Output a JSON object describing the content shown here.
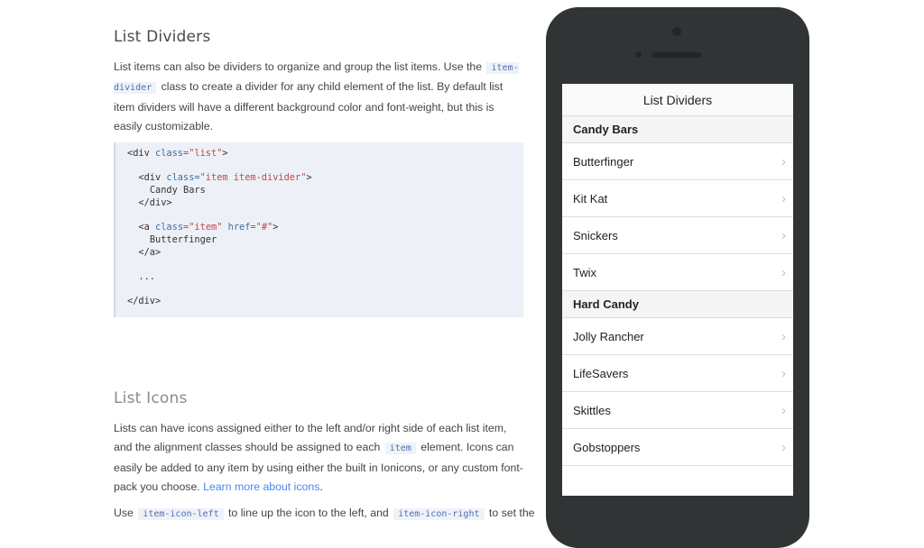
{
  "docs": {
    "section1": {
      "title": "List Dividers",
      "para": {
        "a": "List items can also be dividers to organize and group the list items. Use the",
        "code": "item-divider",
        "b": "class to create a divider for any child element of the list. By default list item dividers will have a different background color and font-weight, but this is easily customizable."
      },
      "code": {
        "tag1": "<div ",
        "attr1": "class=",
        "str1": "\"list\"",
        "end1": ">",
        "tag2": "<div ",
        "attr2": "class=",
        "str2": "\"item item-divider\"",
        "end2": ">",
        "text2": "Candy Bars",
        "close2": "</div>",
        "tag3": "<a ",
        "attr3a": "class=",
        "str3a": "\"item\"",
        "attr3b": " href=",
        "str3b": "\"#\"",
        "end3": ">",
        "text3": "Butterfinger",
        "close3": "</a>",
        "ellipsis": "...",
        "close1": "</div>"
      }
    },
    "section2": {
      "title": "List Icons",
      "para": {
        "a": "Lists can have icons assigned either to the left and/or right side of each list item, and the alignment classes should be assigned to each",
        "code": "item",
        "b": "element. Icons can easily be added to any item by using either the built in Ionicons, or any custom font-pack you choose.",
        "link": "Learn more about icons",
        "end": "."
      },
      "cut": {
        "a": "Use",
        "code1": "item-icon-left",
        "b": "to line up the icon to the left, and",
        "code2": "item-icon-right",
        "c": "to set the"
      }
    }
  },
  "phone": {
    "header_title": "List Dividers",
    "groups": [
      {
        "divider": "Candy Bars",
        "items": [
          "Butterfinger",
          "Kit Kat",
          "Snickers",
          "Twix"
        ]
      },
      {
        "divider": "Hard Candy",
        "items": [
          "Jolly Rancher",
          "LifeSavers",
          "Skittles",
          "Gobstoppers"
        ]
      }
    ],
    "chevron": "›"
  }
}
